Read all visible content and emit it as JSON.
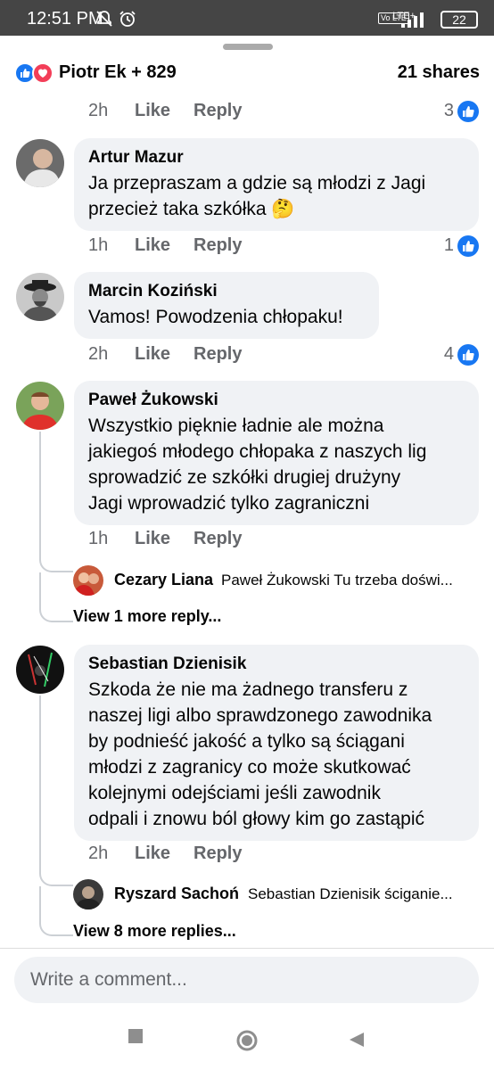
{
  "status_bar": {
    "time": "12:51 PM",
    "network": "LTE+",
    "volte": "Vo LTE",
    "battery": "22",
    "icons": [
      "notifications-off-icon",
      "alarm-icon",
      "signal-icon",
      "battery-icon"
    ]
  },
  "summary": {
    "reactors": "Piotr Ek + 829",
    "shares": "21 shares",
    "reaction_icons": [
      "like-icon",
      "love-icon"
    ]
  },
  "first_meta": {
    "time": "2h",
    "like": "Like",
    "reply": "Reply",
    "likes": "3"
  },
  "comments": [
    {
      "name": "Artur Mazur",
      "text": "Ja przepraszam a gdzie są młodzi z Jagi\nprzecież taka  szkółka 🤔",
      "time": "1h",
      "like": "Like",
      "reply": "Reply",
      "likes": "1"
    },
    {
      "name": "Marcin Koziński",
      "text": "Vamos! Powodzenia chłopaku!",
      "time": "2h",
      "like": "Like",
      "reply": "Reply",
      "likes": "4"
    },
    {
      "name": "Paweł Żukowski",
      "text": "Wszystkio pięknie ładnie ale można\njakiegoś młodego chłopaka z naszych lig\nsprowadzić ze szkółki drugiej drużyny\nJagi wprowadzić tylko zagraniczni",
      "time": "1h",
      "like": "Like",
      "reply": "Reply",
      "reply_preview": {
        "name": "Cezary Liana",
        "text": "Paweł Żukowski Tu trzeba doświ..."
      },
      "view_more": "View 1 more reply..."
    },
    {
      "name": "Sebastian Dzienisik",
      "text": "Szkoda że nie ma żadnego transferu z\nnaszej ligi albo sprawdzonego zawodnika\nby podnieść jakość a tylko są ściągani\nmłodzi z zagranicy co może skutkować\nkolejnymi odejściami jeśli zawodnik\nodpali i znowu ból głowy kim go zastąpić",
      "time": "2h",
      "like": "Like",
      "reply": "Reply",
      "reply_preview": {
        "name": "Ryszard Sachoń",
        "text": "Sebastian Dzienisik ściganie..."
      },
      "view_more": "View 8 more replies..."
    }
  ],
  "composer": {
    "placeholder": "Write a comment..."
  },
  "navbar": {
    "icons": [
      "recent-apps-icon",
      "home-icon",
      "back-icon"
    ]
  },
  "colors": {
    "accent": "#1877f2",
    "love": "#f33e58",
    "bubble": "#f0f2f5",
    "meta": "#65676b",
    "status_bar": "#454545"
  }
}
